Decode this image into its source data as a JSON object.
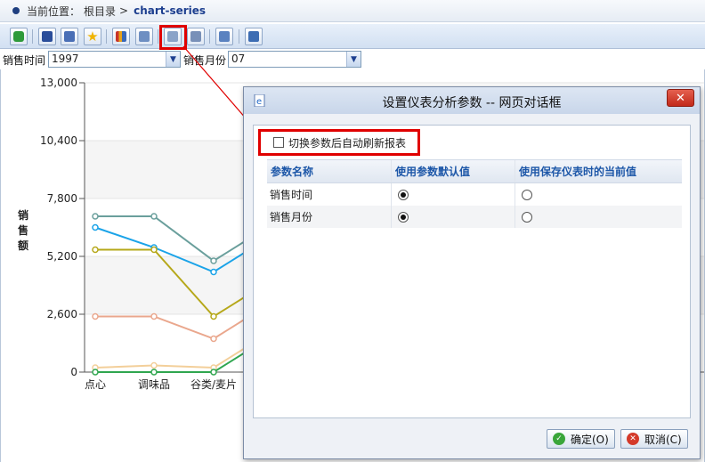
{
  "breadcrumb": {
    "label": "当前位置：",
    "root": "根目录",
    "separator": ">",
    "current": "chart-series"
  },
  "params": {
    "time_label": "销售时间",
    "time_value": "1997",
    "month_label": "销售月份",
    "month_value": "07"
  },
  "chart_data": {
    "type": "line",
    "ylabel": "销售额",
    "ylim": [
      0,
      13000
    ],
    "yticks": [
      "0",
      "2,600",
      "5,200",
      "7,800",
      "10,400",
      "13,000"
    ],
    "categories": [
      "点心",
      "调味品",
      "谷类/麦片"
    ],
    "series": [
      {
        "color": "#6a9f9c",
        "values": [
          7000,
          7000,
          5000
        ]
      },
      {
        "color": "#1aa3e8",
        "values": [
          6500,
          5600,
          4500
        ]
      },
      {
        "color": "#b6a81a",
        "values": [
          5500,
          5500,
          2500
        ]
      },
      {
        "color": "#eaa78d",
        "values": [
          2500,
          2500,
          1500
        ]
      },
      {
        "color": "#f3cf9a",
        "values": [
          200,
          300,
          200
        ]
      },
      {
        "color": "#2fa64f",
        "values": [
          0,
          0,
          0
        ]
      }
    ]
  },
  "dialog": {
    "title": "设置仪表分析参数 -- 网页对话框",
    "close_label": "✕",
    "checkbox_label": "切换参数后自动刷新报表",
    "columns": [
      "参数名称",
      "使用参数默认值",
      "使用保存仪表时的当前值"
    ],
    "rows": [
      {
        "name": "销售时间",
        "default": true
      },
      {
        "name": "销售月份",
        "default": true
      }
    ],
    "ok_label": "确定(O)",
    "cancel_label": "取消(C)"
  }
}
